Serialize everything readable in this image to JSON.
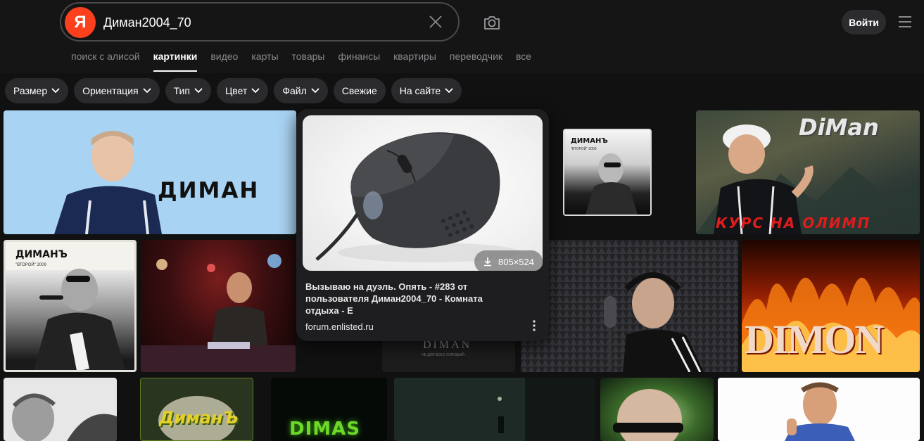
{
  "header": {
    "logo_letter": "Я",
    "search_value": "Диман2004_70",
    "login_label": "Войти"
  },
  "nav": {
    "items": [
      {
        "label": "поиск с алисой"
      },
      {
        "label": "картинки",
        "active": true
      },
      {
        "label": "видео"
      },
      {
        "label": "карты"
      },
      {
        "label": "товары"
      },
      {
        "label": "финансы"
      },
      {
        "label": "квартиры"
      },
      {
        "label": "переводчик"
      },
      {
        "label": "все"
      }
    ]
  },
  "filters": {
    "items": [
      {
        "label": "Размер",
        "dropdown": true
      },
      {
        "label": "Ориентация",
        "dropdown": true
      },
      {
        "label": "Тип",
        "dropdown": true
      },
      {
        "label": "Цвет",
        "dropdown": true
      },
      {
        "label": "Файл",
        "dropdown": true
      },
      {
        "label": "Свежие",
        "dropdown": false
      },
      {
        "label": "На сайте",
        "dropdown": true
      }
    ]
  },
  "grid": {
    "t1_text": "ДИМАН",
    "t2_text": "ДИМАНЪ",
    "t2_sub": "\"ВТОРОЙ\" 2009",
    "t3_title": "DiMan",
    "t3_caption": "КУРС НА ОЛИМП",
    "t4_text": "ДИМАНЪ",
    "t4_sub": "\"ВТОРОЙ\" 2009",
    "t6_text": "DIMAN",
    "t6_sub": "НЕ ДЛЯ ВСЕХ ХОРОШИЙ",
    "t8_text": "DIMON",
    "t10_text": "ДиманЪ",
    "t11_text": "DIMAS"
  },
  "popup": {
    "size_label": "805×524",
    "title": "Вызываю на дуэль. Опять - #283 от пользователя Диман2004_70 - Комната отдыха - Е",
    "source": "forum.enlisted.ru"
  },
  "colors": {
    "background": "#111112",
    "logo": "#fc3f1d",
    "chip": "#2a2a2d"
  }
}
